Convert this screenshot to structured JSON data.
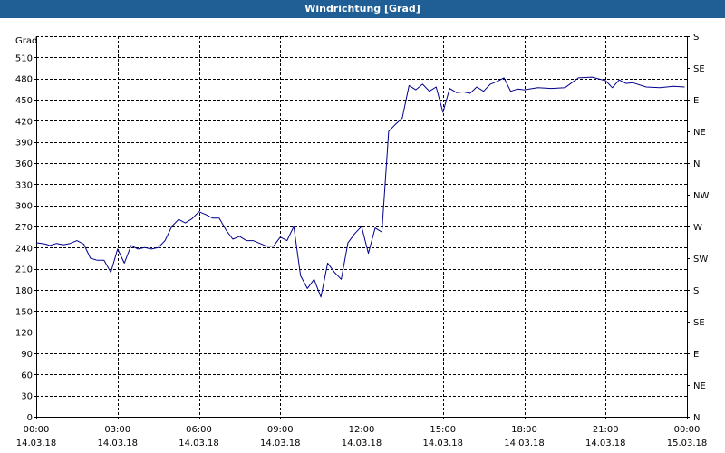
{
  "window": {
    "title": "Windrichtung [Grad]"
  },
  "colors": {
    "titlebar": "#1f5f95",
    "line": "#00008b",
    "grid": "#000000",
    "background": "#ffffff"
  },
  "chart_data": {
    "type": "line",
    "title": "Windrichtung [Grad]",
    "ylabel": "Grad",
    "ylim": [
      0,
      540
    ],
    "yticks": [
      0,
      30,
      60,
      90,
      120,
      150,
      180,
      210,
      240,
      270,
      300,
      330,
      360,
      390,
      420,
      450,
      480,
      510
    ],
    "y2_ticks": [
      "N",
      "NE",
      "E",
      "SE",
      "S",
      "SW",
      "W",
      "NW",
      "N",
      "NE",
      "E",
      "SE",
      "S"
    ],
    "xlim": [
      "14.03.18 00:00",
      "15.03.18 00:00"
    ],
    "x_tick_labels": [
      {
        "time": "00:00",
        "date": "14.03.18"
      },
      {
        "time": "03:00",
        "date": "14.03.18"
      },
      {
        "time": "06:00",
        "date": "14.03.18"
      },
      {
        "time": "09:00",
        "date": "14.03.18"
      },
      {
        "time": "12:00",
        "date": "14.03.18"
      },
      {
        "time": "15:00",
        "date": "14.03.18"
      },
      {
        "time": "18:00",
        "date": "14.03.18"
      },
      {
        "time": "21:00",
        "date": "14.03.18"
      },
      {
        "time": "00:00",
        "date": "15.03.18"
      }
    ],
    "grid": true,
    "series": [
      {
        "x": [
          "00:00",
          "00:20",
          "00:30",
          "00:45",
          "01:00",
          "01:15",
          "01:30",
          "01:45",
          "02:00",
          "02:15",
          "02:30",
          "02:45",
          "03:00",
          "03:15",
          "03:30",
          "03:45",
          "04:00",
          "04:15",
          "04:30",
          "04:45",
          "05:00",
          "05:15",
          "05:30",
          "05:45",
          "06:00",
          "06:15",
          "06:30",
          "06:45",
          "07:00",
          "07:15",
          "07:30",
          "07:45",
          "08:00",
          "08:15",
          "08:30",
          "08:45",
          "09:00",
          "09:15",
          "09:30",
          "09:45",
          "10:00",
          "10:15",
          "10:30",
          "10:45",
          "11:00",
          "11:15",
          "11:30",
          "11:45",
          "12:00",
          "12:15",
          "12:30",
          "12:45",
          "13:00",
          "13:15",
          "13:30",
          "13:45",
          "14:00",
          "14:15",
          "14:30",
          "14:45",
          "15:00",
          "15:15",
          "15:30",
          "15:45",
          "16:00",
          "16:15",
          "16:30",
          "16:45",
          "17:00",
          "17:15",
          "17:30",
          "17:45",
          "18:00",
          "18:30",
          "19:00",
          "19:30",
          "20:00",
          "20:30",
          "21:00",
          "21:15",
          "21:30",
          "21:45",
          "22:00",
          "22:30",
          "23:00",
          "23:30",
          "23:55"
        ],
        "y": [
          247,
          245,
          243,
          246,
          244,
          246,
          250,
          245,
          225,
          222,
          222,
          205,
          238,
          218,
          243,
          238,
          240,
          238,
          240,
          250,
          270,
          280,
          275,
          281,
          291,
          287,
          282,
          282,
          265,
          252,
          256,
          250,
          250,
          246,
          242,
          242,
          255,
          250,
          270,
          200,
          182,
          195,
          170,
          218,
          205,
          195,
          247,
          260,
          270,
          232,
          268,
          262,
          405,
          415,
          424,
          470,
          464,
          472,
          462,
          468,
          432,
          466,
          460,
          461,
          459,
          468,
          462,
          472,
          476,
          481,
          462,
          465,
          464,
          467,
          466,
          467,
          481,
          482,
          477,
          467,
          478,
          473,
          474,
          468,
          467,
          469,
          468
        ]
      }
    ]
  }
}
